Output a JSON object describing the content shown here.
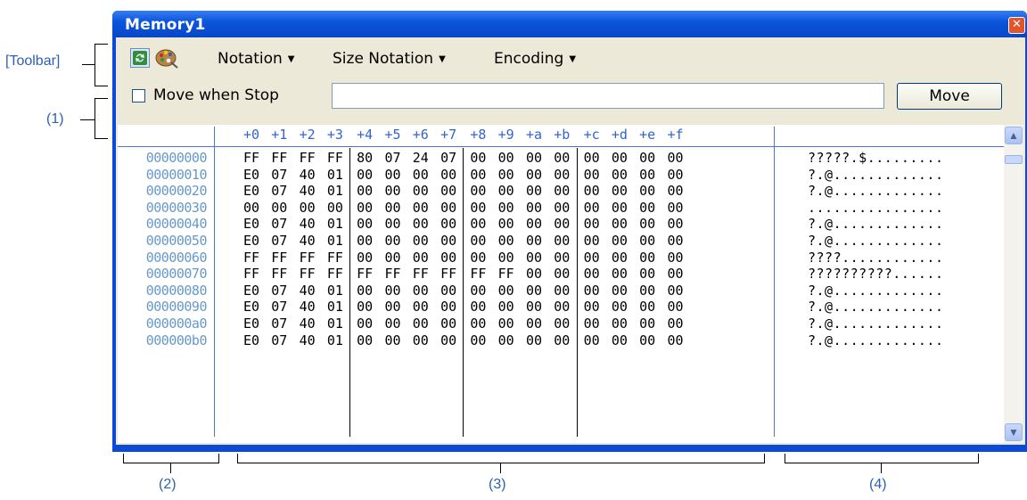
{
  "callouts": {
    "toolbar": "[Toolbar]",
    "c1": "(1)",
    "c2": "(2)",
    "c3": "(3)",
    "c4": "(4)"
  },
  "window": {
    "title": "Memory1",
    "close_icon": "close-icon"
  },
  "toolbar": {
    "refresh_icon": "refresh-icon",
    "palette_icon": "palette-icon",
    "menus": [
      "Notation",
      "Size Notation",
      "Encoding"
    ]
  },
  "row1": {
    "checkbox_label": "Move when Stop",
    "checkbox_checked": false,
    "address_value": "",
    "move_button": "Move"
  },
  "memory": {
    "header": [
      "+0",
      "+1",
      "+2",
      "+3",
      "+4",
      "+5",
      "+6",
      "+7",
      "+8",
      "+9",
      "+a",
      "+b",
      "+c",
      "+d",
      "+e",
      "+f"
    ],
    "rows": [
      {
        "addr": "00000000",
        "bytes": [
          "FF",
          "FF",
          "FF",
          "FF",
          "80",
          "07",
          "24",
          "07",
          "00",
          "00",
          "00",
          "00",
          "00",
          "00",
          "00",
          "00"
        ],
        "ascii": "?????.$........."
      },
      {
        "addr": "00000010",
        "bytes": [
          "E0",
          "07",
          "40",
          "01",
          "00",
          "00",
          "00",
          "00",
          "00",
          "00",
          "00",
          "00",
          "00",
          "00",
          "00",
          "00"
        ],
        "ascii": "?.@............."
      },
      {
        "addr": "00000020",
        "bytes": [
          "E0",
          "07",
          "40",
          "01",
          "00",
          "00",
          "00",
          "00",
          "00",
          "00",
          "00",
          "00",
          "00",
          "00",
          "00",
          "00"
        ],
        "ascii": "?.@............."
      },
      {
        "addr": "00000030",
        "bytes": [
          "00",
          "00",
          "00",
          "00",
          "00",
          "00",
          "00",
          "00",
          "00",
          "00",
          "00",
          "00",
          "00",
          "00",
          "00",
          "00"
        ],
        "ascii": "................"
      },
      {
        "addr": "00000040",
        "bytes": [
          "E0",
          "07",
          "40",
          "01",
          "00",
          "00",
          "00",
          "00",
          "00",
          "00",
          "00",
          "00",
          "00",
          "00",
          "00",
          "00"
        ],
        "ascii": "?.@............."
      },
      {
        "addr": "00000050",
        "bytes": [
          "E0",
          "07",
          "40",
          "01",
          "00",
          "00",
          "00",
          "00",
          "00",
          "00",
          "00",
          "00",
          "00",
          "00",
          "00",
          "00"
        ],
        "ascii": "?.@............."
      },
      {
        "addr": "00000060",
        "bytes": [
          "FF",
          "FF",
          "FF",
          "FF",
          "00",
          "00",
          "00",
          "00",
          "00",
          "00",
          "00",
          "00",
          "00",
          "00",
          "00",
          "00"
        ],
        "ascii": "????............"
      },
      {
        "addr": "00000070",
        "bytes": [
          "FF",
          "FF",
          "FF",
          "FF",
          "FF",
          "FF",
          "FF",
          "FF",
          "FF",
          "FF",
          "00",
          "00",
          "00",
          "00",
          "00",
          "00"
        ],
        "ascii": "??????????......"
      },
      {
        "addr": "00000080",
        "bytes": [
          "E0",
          "07",
          "40",
          "01",
          "00",
          "00",
          "00",
          "00",
          "00",
          "00",
          "00",
          "00",
          "00",
          "00",
          "00",
          "00"
        ],
        "ascii": "?.@............."
      },
      {
        "addr": "00000090",
        "bytes": [
          "E0",
          "07",
          "40",
          "01",
          "00",
          "00",
          "00",
          "00",
          "00",
          "00",
          "00",
          "00",
          "00",
          "00",
          "00",
          "00"
        ],
        "ascii": "?.@............."
      },
      {
        "addr": "000000a0",
        "bytes": [
          "E0",
          "07",
          "40",
          "01",
          "00",
          "00",
          "00",
          "00",
          "00",
          "00",
          "00",
          "00",
          "00",
          "00",
          "00",
          "00"
        ],
        "ascii": "?.@............."
      },
      {
        "addr": "000000b0",
        "bytes": [
          "E0",
          "07",
          "40",
          "01",
          "00",
          "00",
          "00",
          "00",
          "00",
          "00",
          "00",
          "00",
          "00",
          "00",
          "00",
          "00"
        ],
        "ascii": "?.@............."
      }
    ]
  },
  "scrollbar": {
    "up_icon": "scroll-up-icon",
    "down_icon": "scroll-down-icon"
  }
}
